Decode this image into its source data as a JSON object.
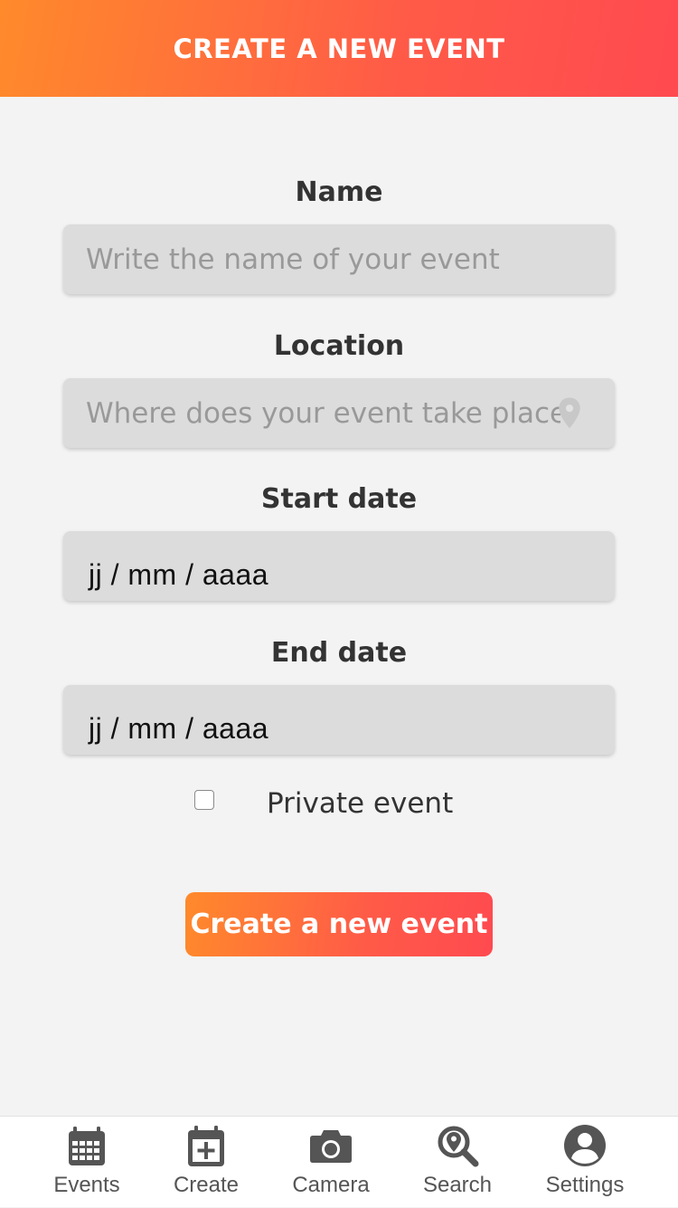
{
  "header": {
    "title": "CREATE A NEW EVENT"
  },
  "form": {
    "name": {
      "label": "Name",
      "placeholder": "Write the name of your event",
      "value": ""
    },
    "location": {
      "label": "Location",
      "placeholder": "Where does your event take place",
      "value": "",
      "icon": "location-pin-icon"
    },
    "start_date": {
      "label": "Start date",
      "value": "jj / mm / aaaa"
    },
    "end_date": {
      "label": "End date",
      "value": "jj / mm / aaaa"
    },
    "private": {
      "label": "Private event",
      "checked": false
    },
    "submit_label": "Create a new event"
  },
  "bottom_nav": {
    "items": [
      {
        "label": "Events",
        "icon": "calendar-grid-icon"
      },
      {
        "label": "Create",
        "icon": "calendar-plus-icon"
      },
      {
        "label": "Camera",
        "icon": "camera-icon"
      },
      {
        "label": "Search",
        "icon": "search-location-icon"
      },
      {
        "label": "Settings",
        "icon": "user-circle-icon"
      }
    ]
  },
  "colors": {
    "accent_start": "#ff8a2b",
    "accent_end": "#ff4a50",
    "background": "#f3f3f3",
    "input_background": "#dcdcdc",
    "text": "#333333",
    "nav_icon": "#555555"
  }
}
